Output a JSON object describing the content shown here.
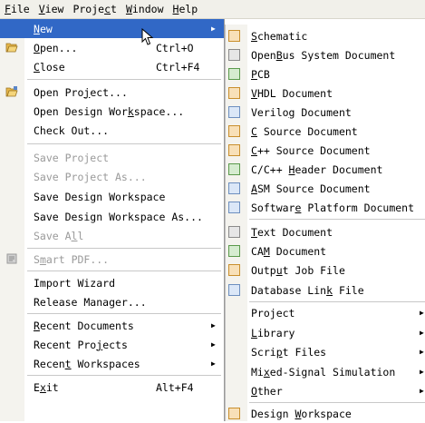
{
  "menubar": {
    "items": [
      {
        "pre": "",
        "u": "F",
        "post": "ile"
      },
      {
        "pre": "",
        "u": "V",
        "post": "iew"
      },
      {
        "pre": "Proje",
        "u": "c",
        "post": "t"
      },
      {
        "pre": "",
        "u": "W",
        "post": "indow"
      },
      {
        "pre": "",
        "u": "H",
        "post": "elp"
      }
    ]
  },
  "file_menu": {
    "items": [
      {
        "pre": "",
        "u": "N",
        "post": "ew",
        "shortcut": "",
        "submenu": true,
        "state": "highlighted",
        "icon": ""
      },
      {
        "pre": "",
        "u": "O",
        "post": "pen...",
        "shortcut": "Ctrl+O",
        "submenu": false,
        "state": "enabled",
        "icon": "folder-open-icon"
      },
      {
        "pre": "",
        "u": "C",
        "post": "lose",
        "shortcut": "Ctrl+F4",
        "submenu": false,
        "state": "enabled",
        "icon": ""
      },
      {
        "pre": "Open Pro",
        "u": "j",
        "post": "ect...",
        "shortcut": "",
        "submenu": false,
        "state": "enabled",
        "icon": "open-project-icon"
      },
      {
        "pre": "Open Design Wor",
        "u": "k",
        "post": "space...",
        "shortcut": "",
        "submenu": false,
        "state": "enabled",
        "icon": ""
      },
      {
        "pre": "Check Out...",
        "u": "",
        "post": "",
        "shortcut": "",
        "submenu": false,
        "state": "enabled",
        "icon": ""
      },
      {
        "pre": "Save Project",
        "u": "",
        "post": "",
        "shortcut": "",
        "submenu": false,
        "state": "disabled",
        "icon": ""
      },
      {
        "pre": "Save Project As...",
        "u": "",
        "post": "",
        "shortcut": "",
        "submenu": false,
        "state": "disabled",
        "icon": ""
      },
      {
        "pre": "Save Design Workspace",
        "u": "",
        "post": "",
        "shortcut": "",
        "submenu": false,
        "state": "enabled",
        "icon": ""
      },
      {
        "pre": "Save Design Workspace As...",
        "u": "",
        "post": "",
        "shortcut": "",
        "submenu": false,
        "state": "enabled",
        "icon": ""
      },
      {
        "pre": "Save A",
        "u": "l",
        "post": "l",
        "shortcut": "",
        "submenu": false,
        "state": "disabled",
        "icon": ""
      },
      {
        "pre": "S",
        "u": "m",
        "post": "art PDF...",
        "shortcut": "",
        "submenu": false,
        "state": "disabled",
        "icon": "smart-pdf-icon"
      },
      {
        "pre": "Import Wizard",
        "u": "",
        "post": "",
        "shortcut": "",
        "submenu": false,
        "state": "enabled",
        "icon": ""
      },
      {
        "pre": "Release Manager...",
        "u": "",
        "post": "",
        "shortcut": "",
        "submenu": false,
        "state": "enabled",
        "icon": ""
      },
      {
        "pre": "",
        "u": "R",
        "post": "ecent Documents",
        "shortcut": "",
        "submenu": true,
        "state": "enabled",
        "icon": ""
      },
      {
        "pre": "Recent Pro",
        "u": "j",
        "post": "ects",
        "shortcut": "",
        "submenu": true,
        "state": "enabled",
        "icon": ""
      },
      {
        "pre": "Recen",
        "u": "t",
        "post": " Workspaces",
        "shortcut": "",
        "submenu": true,
        "state": "enabled",
        "icon": ""
      },
      {
        "pre": "E",
        "u": "x",
        "post": "it",
        "shortcut": "Alt+F4",
        "submenu": false,
        "state": "enabled",
        "icon": ""
      }
    ]
  },
  "new_menu": {
    "items": [
      {
        "pre": "",
        "u": "S",
        "post": "chematic",
        "submenu": false,
        "icon": "schematic-icon"
      },
      {
        "pre": "Open",
        "u": "B",
        "post": "us System Document",
        "submenu": false,
        "icon": "openbus-icon"
      },
      {
        "pre": "",
        "u": "P",
        "post": "CB",
        "submenu": false,
        "icon": "pcb-icon"
      },
      {
        "pre": "",
        "u": "V",
        "post": "HDL Document",
        "submenu": false,
        "icon": "vhdl-document-icon"
      },
      {
        "pre": "Verilo",
        "u": "g",
        "post": " Document",
        "submenu": false,
        "icon": "verilog-document-icon"
      },
      {
        "pre": "",
        "u": "C",
        "post": " Source Document",
        "submenu": false,
        "icon": "c-source-icon"
      },
      {
        "pre": "",
        "u": "C",
        "post": "++ Source Document",
        "submenu": false,
        "icon": "cpp-source-icon"
      },
      {
        "pre": "C/C++ ",
        "u": "H",
        "post": "eader Document",
        "submenu": false,
        "icon": "header-document-icon"
      },
      {
        "pre": "",
        "u": "A",
        "post": "SM Source Document",
        "submenu": false,
        "icon": "asm-source-icon"
      },
      {
        "pre": "Softwar",
        "u": "e",
        "post": " Platform Document",
        "submenu": false,
        "icon": "software-platform-icon"
      },
      {
        "pre": "",
        "u": "T",
        "post": "ext Document",
        "submenu": false,
        "icon": "text-document-icon"
      },
      {
        "pre": "CA",
        "u": "M",
        "post": " Document",
        "submenu": false,
        "icon": "cam-document-icon"
      },
      {
        "pre": "Outp",
        "u": "u",
        "post": "t Job File",
        "submenu": false,
        "icon": "output-job-icon"
      },
      {
        "pre": "Database Lin",
        "u": "k",
        "post": " File",
        "submenu": false,
        "icon": "database-link-icon"
      },
      {
        "pre": "Project",
        "u": "",
        "post": "",
        "submenu": true,
        "icon": ""
      },
      {
        "pre": "",
        "u": "L",
        "post": "ibrary",
        "submenu": true,
        "icon": ""
      },
      {
        "pre": "Scri",
        "u": "p",
        "post": "t Files",
        "submenu": true,
        "icon": ""
      },
      {
        "pre": "Mi",
        "u": "x",
        "post": "ed-Signal Simulation",
        "submenu": true,
        "icon": ""
      },
      {
        "pre": "",
        "u": "O",
        "post": "ther",
        "submenu": true,
        "icon": ""
      },
      {
        "pre": "Design ",
        "u": "W",
        "post": "orkspace",
        "submenu": false,
        "icon": "design-workspace-icon"
      }
    ]
  },
  "colors": {
    "highlight": "#3168c6",
    "disabled_text": "#9a9a9a"
  }
}
